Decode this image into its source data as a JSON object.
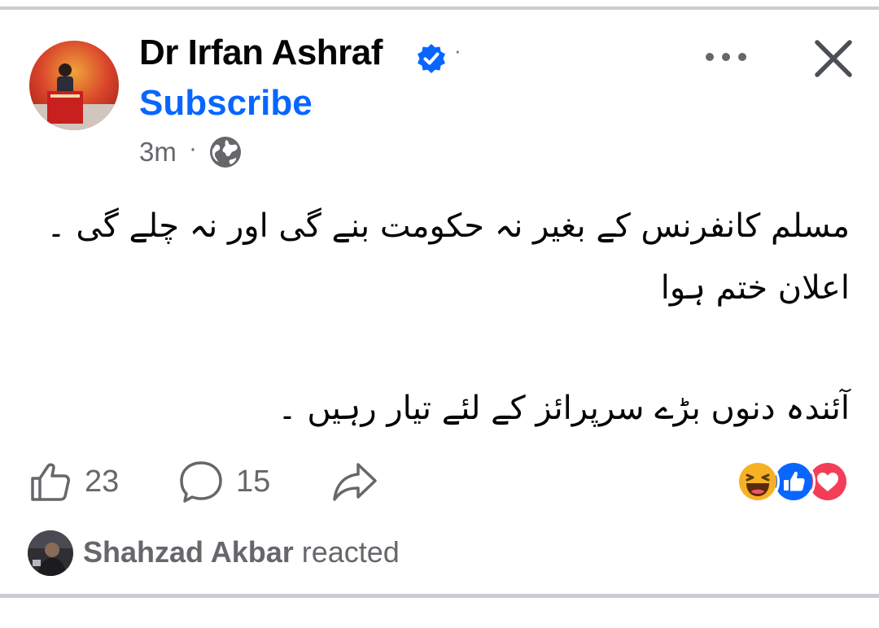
{
  "post": {
    "author": "Dr Irfan Ashraf",
    "subscribe_label": "Subscribe",
    "timestamp": "3m",
    "meta_separator": "·",
    "name_separator": "·",
    "audience_icon": "globe-icon",
    "verified_icon": "verified-badge-icon",
    "text_lines": [
      "مسلم کانفرنس کے بغیر نہ حکومت بنے گی اور نہ چلے گی ۔",
      "اعلان ختم ہوا",
      "",
      "آئندہ دنوں بڑے سرپرائز کے لئے تیار رہیں ۔"
    ]
  },
  "actions": {
    "like_count": "23",
    "comment_count": "15",
    "like_icon": "thumbs-up-icon",
    "comment_icon": "comment-bubble-icon",
    "share_icon": "share-arrow-icon"
  },
  "reactions": [
    "haha",
    "like",
    "love"
  ],
  "reactor": {
    "name": "Shahzad Akbar",
    "action_text": "reacted"
  },
  "colors": {
    "accent": "#0866ff",
    "secondary_text": "#65676b",
    "love": "#f33e58",
    "haha": "#f7b125"
  }
}
